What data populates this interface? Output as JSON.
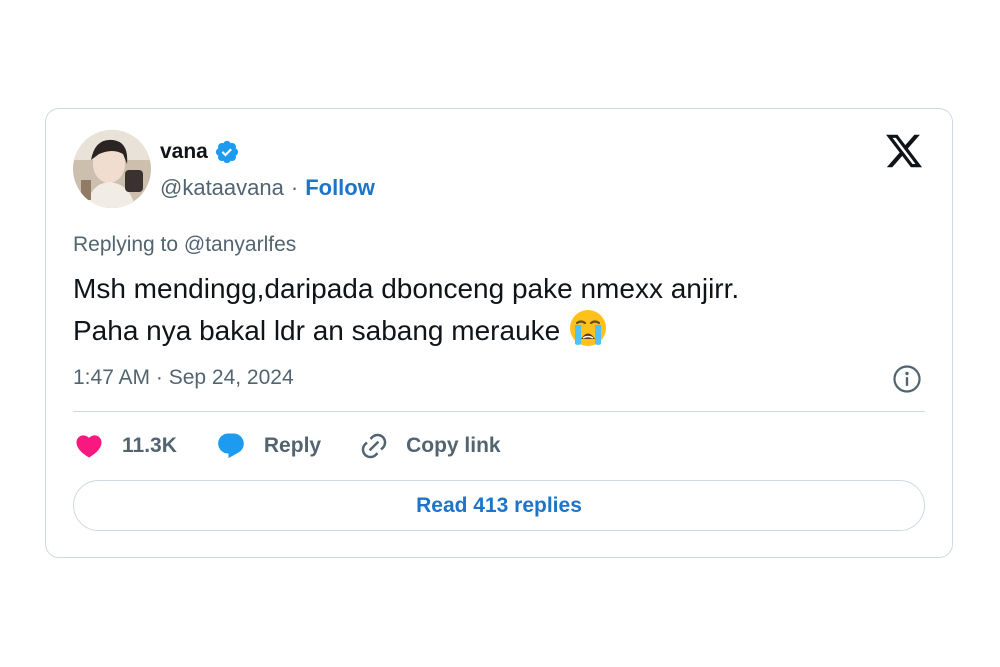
{
  "author": {
    "name": "vana",
    "handle": "@kataavana",
    "separator": "·",
    "follow_label": "Follow"
  },
  "tweet": {
    "replying_to": "Replying to @tanyarlfes",
    "line1": "Msh mendingg,daripada dbonceng pake nmexx anjirr.",
    "line2": "Paha nya bakal ldr an sabang merauke",
    "emoji_name": "loudly-crying-face",
    "timestamp": "1:47 AM · Sep 24, 2024"
  },
  "actions": {
    "like_count": "11.3K",
    "reply_label": "Reply",
    "copy_label": "Copy link",
    "read_replies_label": "Read 413 replies"
  },
  "icons": {
    "verified": "verified-badge-icon",
    "x_logo": "x-logo-icon",
    "info": "info-icon",
    "heart": "heart-icon",
    "reply": "speech-bubble-icon",
    "link": "link-icon"
  },
  "colors": {
    "link_blue": "#1d74c9",
    "verified_blue": "#1d9bf0",
    "heart_pink": "#f91880",
    "text_primary": "#0f1419",
    "text_secondary": "#536471",
    "border": "#cfd9de"
  }
}
